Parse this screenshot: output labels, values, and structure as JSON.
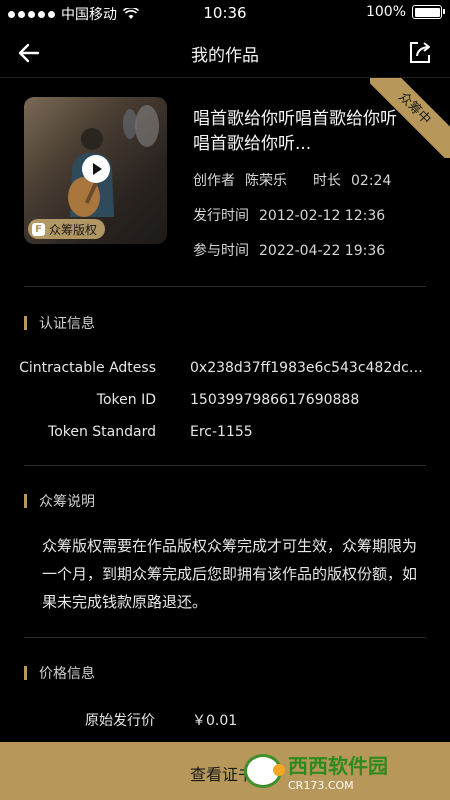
{
  "status_bar": {
    "carrier": "中国移动",
    "time": "10:36",
    "battery": "100%"
  },
  "nav": {
    "title": "我的作品"
  },
  "ribbon": {
    "label": "众筹中"
  },
  "work": {
    "badge_letter": "F",
    "badge_label": "众筹版权",
    "title": "唱首歌给你听唱首歌给你听唱首歌给你听...",
    "creator_label": "创作者",
    "creator_value": "陈荣乐",
    "duration_label": "时长",
    "duration_value": "02:24",
    "release_label": "发行时间",
    "release_value": "2012-02-12 12:36",
    "join_label": "参与时间",
    "join_value": "2022-04-22 19:36"
  },
  "cert": {
    "heading": "认证信息",
    "rows": [
      {
        "label": "Cintractable Adtess",
        "value": "0x238d37ff1983e6c543c482dce..."
      },
      {
        "label": "Token ID",
        "value": "1503997986617690888"
      },
      {
        "label": "Token Standard",
        "value": "Erc-1155"
      }
    ]
  },
  "crowdfund": {
    "heading": "众筹说明",
    "text": "众筹版权需要在作品版权众筹完成才可生效，众筹期限为一个月，到期众筹完成后您即拥有该作品的版权份额，如果未完成钱款原路退还。"
  },
  "price": {
    "heading": "价格信息",
    "label": "原始发行价",
    "value": "￥0.01"
  },
  "bottom": {
    "label": "查看证书"
  },
  "watermark": {
    "word": "西西软件园",
    "sub": "CR173.COM"
  },
  "colors": {
    "accent": "#b8985a",
    "background": "#000000"
  }
}
